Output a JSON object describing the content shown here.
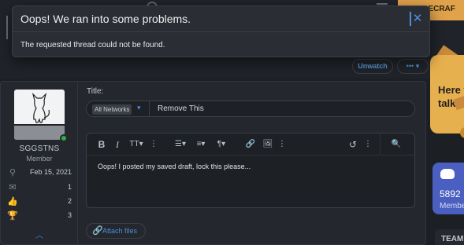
{
  "background": {
    "top_button": "UBECRAF",
    "side_prompt": "Here t\ntalk?",
    "discord_count": "5892",
    "discord_label": "Membe",
    "team_label": "TEAM"
  },
  "error_toast": {
    "title": "Oops! We ran into some problems.",
    "message": "The requested thread could not be found.",
    "close_glyph": "✕"
  },
  "thread_actions": {
    "unwatch_label": "Unwatch",
    "more_label": "••• ▾"
  },
  "user": {
    "name": "SGGSTNS",
    "role": "Member",
    "stats": [
      {
        "icon": "person-icon",
        "glyph": "⚲",
        "value": "Feb 15, 2021"
      },
      {
        "icon": "messages-icon",
        "glyph": "✉",
        "value": "1"
      },
      {
        "icon": "thumbs-up-icon",
        "glyph": "👍",
        "value": "2"
      },
      {
        "icon": "trophy-icon",
        "glyph": "🏆",
        "value": "3"
      }
    ],
    "collapse_glyph": "︿"
  },
  "form": {
    "title_label": "Title:",
    "prefix_value": "All Networks",
    "prefix_caret": "▾",
    "title_value": "Remove This",
    "content": "Oops! I posted my saved draft, lock this please...",
    "attach_label": "Attach files",
    "attach_icon": "🔗"
  },
  "toolbar": [
    {
      "name": "bold-icon",
      "glyph": "B"
    },
    {
      "name": "italic-icon",
      "glyph": "I"
    },
    {
      "name": "text-size-icon",
      "glyph": "TT▾"
    },
    {
      "name": "more-text-icon",
      "glyph": "⋮"
    },
    {
      "name": "list-icon",
      "glyph": "☰▾"
    },
    {
      "name": "align-icon",
      "glyph": "≡▾"
    },
    {
      "name": "paragraph-icon",
      "glyph": "¶▾"
    },
    {
      "name": "link-icon",
      "glyph": "🔗"
    },
    {
      "name": "image-icon",
      "glyph": "🖼"
    },
    {
      "name": "more-insert-icon",
      "glyph": "⋮"
    },
    {
      "name": "undo-icon",
      "glyph": "↺"
    },
    {
      "name": "more-actions-icon",
      "glyph": "⋮"
    },
    {
      "name": "preview-icon",
      "glyph": "🔍"
    }
  ],
  "colors": {
    "accent": "#4c8ed8",
    "online": "#2fae4a",
    "brand_orange": "#e0a24a",
    "discord": "#4a5fbf"
  }
}
